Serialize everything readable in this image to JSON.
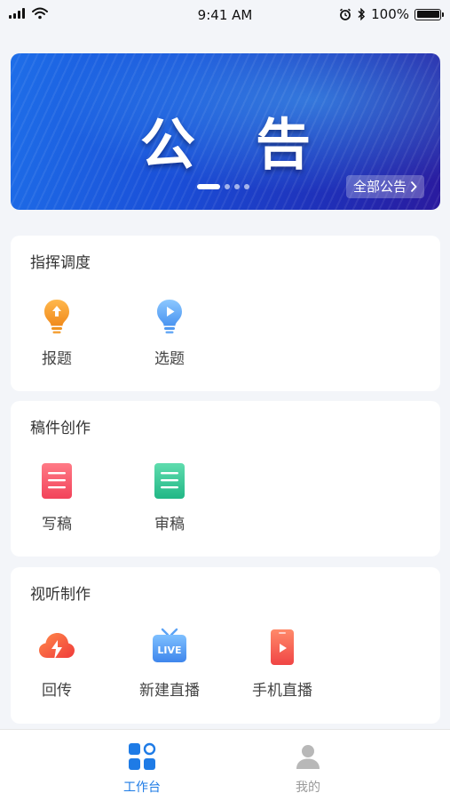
{
  "status_bar": {
    "time": "9:41 AM",
    "battery": "100%"
  },
  "banner": {
    "title": "公告",
    "all_notices_label": "全部公告"
  },
  "sections": [
    {
      "title": "指挥调度",
      "items": [
        {
          "label": "报题",
          "icon": "lightbulb-orange-icon"
        },
        {
          "label": "选题",
          "icon": "lightbulb-blue-icon"
        }
      ]
    },
    {
      "title": "稿件创作",
      "items": [
        {
          "label": "写稿",
          "icon": "document-red-icon"
        },
        {
          "label": "审稿",
          "icon": "document-green-icon"
        }
      ]
    },
    {
      "title": "视听制作",
      "items": [
        {
          "label": "回传",
          "icon": "upload-cloud-icon"
        },
        {
          "label": "新建直播",
          "icon": "live-tv-icon"
        },
        {
          "label": "手机直播",
          "icon": "phone-live-icon"
        }
      ]
    }
  ],
  "tabbar": {
    "items": [
      {
        "label": "工作台",
        "active": true
      },
      {
        "label": "我的",
        "active": false
      }
    ]
  },
  "colors": {
    "accent": "#1e7be6",
    "inactive": "#9a9a9a"
  }
}
